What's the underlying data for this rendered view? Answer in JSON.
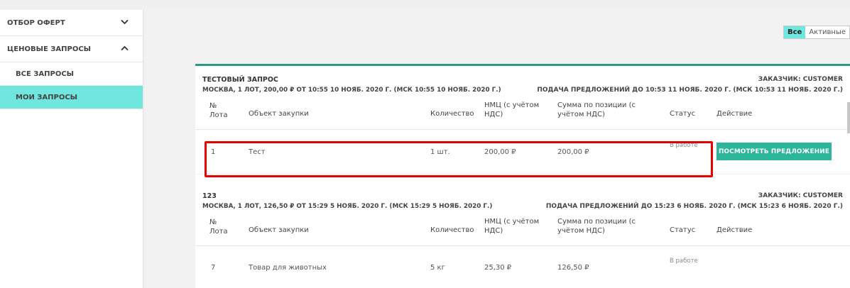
{
  "sidebar": {
    "items": [
      {
        "label": "ОТБОР ОФЕРТ",
        "chevron": "chevron-down"
      },
      {
        "label": "ЦЕНОВЫЕ ЗАПРОСЫ",
        "chevron": "chevron-up"
      }
    ],
    "sub_items": [
      {
        "label": "ВСЕ ЗАПРОСЫ",
        "active": false
      },
      {
        "label": "МОИ ЗАПРОСЫ",
        "active": true
      }
    ]
  },
  "filter": {
    "all_label": "Все",
    "active_label": "Активные"
  },
  "columns": {
    "lot": "№ Лота",
    "object": "Объект закупки",
    "quantity": "Количество",
    "nmc": "НМЦ (с учётом НДС)",
    "sum": "Сумма по позиции (с учётом НДС)",
    "status": "Статус",
    "action": "Действие"
  },
  "requests": [
    {
      "title": "ТЕСТОВЫЙ ЗАПРОС",
      "subtitle": "МОСКВА, 1 ЛОТ, 200,00 ₽ ОТ 10:55 10 НОЯБ. 2020 Г. (МСК 10:55 10 НОЯБ. 2020 Г.)",
      "customer": "ЗАКАЗЧИК: CUSTOMER",
      "deadline": "ПОДАЧА ПРЕДЛОЖЕНИЙ ДО 10:53 11 НОЯБ. 2020 Г. (МСК 10:53 11 НОЯБ. 2020 Г.)",
      "row": {
        "lot": "1",
        "object": "Тест",
        "quantity": "1 шт.",
        "nmc": "200,00 ₽",
        "sum": "200,00 ₽",
        "status": "В работе",
        "action": "ПОСМОТРЕТЬ ПРЕДЛОЖЕНИЕ"
      }
    },
    {
      "title": "123",
      "subtitle": "МОСКВА, 1 ЛОТ, 126,50 ₽ ОТ 15:29 5 НОЯБ. 2020 Г. (МСК 15:29 5 НОЯБ. 2020 Г.)",
      "customer": "ЗАКАЗЧИК: CUSTOMER",
      "deadline": "ПОДАЧА ПРЕДЛОЖЕНИЙ ДО 15:23 6 НОЯБ. 2020 Г. (МСК 15:23 6 НОЯБ. 2020 Г.)",
      "row": {
        "lot": "7",
        "object": "Товар для животных",
        "quantity": "5 кг",
        "nmc": "25,30 ₽",
        "sum": "126,50 ₽",
        "status": "В работе"
      }
    }
  ],
  "colors": {
    "accent_teal": "#6fe7de",
    "button_green": "#2bb59b",
    "card_border": "#2d9a88",
    "highlight_red": "#e60000"
  }
}
